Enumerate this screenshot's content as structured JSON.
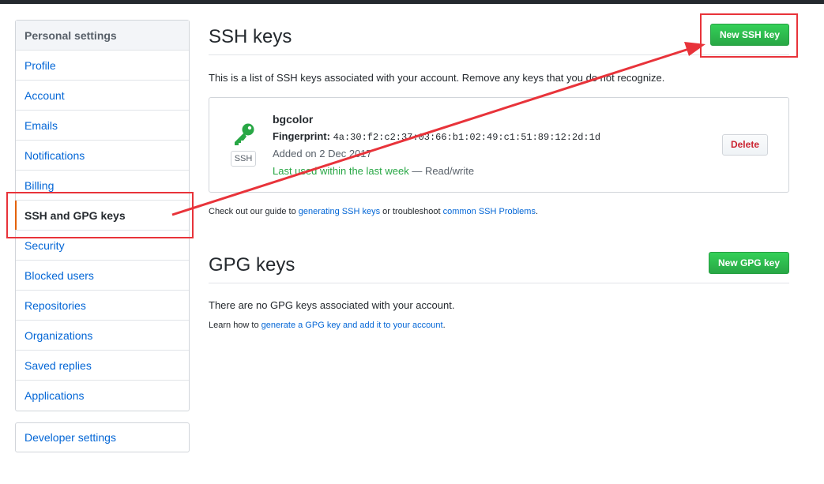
{
  "sidebar": {
    "header": "Personal settings",
    "items": [
      {
        "label": "Profile"
      },
      {
        "label": "Account"
      },
      {
        "label": "Emails"
      },
      {
        "label": "Notifications"
      },
      {
        "label": "Billing"
      },
      {
        "label": "SSH and GPG keys"
      },
      {
        "label": "Security"
      },
      {
        "label": "Blocked users"
      },
      {
        "label": "Repositories"
      },
      {
        "label": "Organizations"
      },
      {
        "label": "Saved replies"
      },
      {
        "label": "Applications"
      }
    ],
    "developer": "Developer settings"
  },
  "ssh": {
    "title": "SSH keys",
    "new_button": "New SSH key",
    "description": "This is a list of SSH keys associated with your account. Remove any keys that you do not recognize.",
    "key": {
      "name": "bgcolor",
      "fingerprint_label": "Fingerprint:",
      "fingerprint": "4a:30:f2:c2:37:03:66:b1:02:49:c1:51:89:12:2d:1d",
      "badge": "SSH",
      "added": "Added on 2 Dec 2017",
      "last_used": "Last used within the last week",
      "access": " — Read/write",
      "delete_button": "Delete"
    },
    "guide_pre": "Check out our guide to ",
    "guide_link1": "generating SSH keys",
    "guide_mid": " or troubleshoot ",
    "guide_link2": "common SSH Problems",
    "guide_post": "."
  },
  "gpg": {
    "title": "GPG keys",
    "new_button": "New GPG key",
    "description": "There are no GPG keys associated with your account.",
    "learn_pre": "Learn how to ",
    "learn_link": "generate a GPG key and add it to your account",
    "learn_post": "."
  },
  "colors": {
    "annotation": "#e8333a",
    "primary_green": "#28a745",
    "link_blue": "#0366d6",
    "active_marker": "#e36209"
  },
  "icons": {
    "key": "key-icon"
  }
}
